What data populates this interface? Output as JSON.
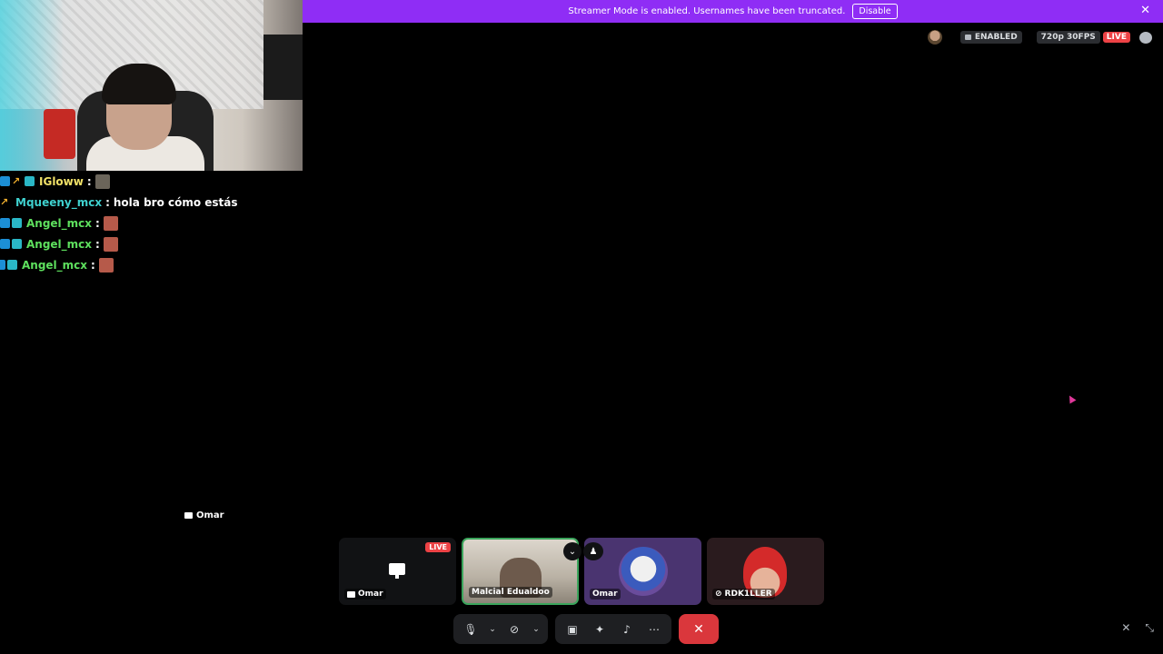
{
  "banner": {
    "message": "Streamer Mode is enabled. Usernames have been truncated.",
    "disable_label": "Disable",
    "close_glyph": "✕"
  },
  "status": {
    "enabled_label": "ENABLED",
    "quality_label": "720p 30FPS",
    "live_label": "LIVE"
  },
  "chat": {
    "messages": [
      {
        "user": "IGloww",
        "text": "",
        "color": "#f2e268"
      },
      {
        "user": "Mqueeny_mcx",
        "text": "hola bro cómo estás",
        "color": "#3fd1cf"
      },
      {
        "user": "Angel_mcx",
        "text": "",
        "color": "#5ee05e"
      },
      {
        "user": "Angel_mcx",
        "text": "",
        "color": "#5ee05e"
      },
      {
        "user": "Angel_mcx",
        "text": "",
        "color": "#5ee05e"
      }
    ],
    "colon": ":"
  },
  "floating_label": "Omar",
  "tiles": [
    {
      "label": "Omar",
      "live": "LIVE"
    },
    {
      "label": "Malcial Edualdoo"
    },
    {
      "label": "Omar"
    },
    {
      "label": "RDK1LLER"
    }
  ],
  "icons": {
    "mic": "mic-icon",
    "camera_off": "camera-off-icon",
    "share_screen": "share-screen-icon",
    "activities": "activities-icon",
    "soundboard": "soundboard-icon",
    "more": "more-icon",
    "disconnect": "disconnect-icon",
    "mute": "volume-mute-icon",
    "fullscreen": "exit-fullscreen-icon"
  },
  "colors": {
    "banner": "#8f2df5",
    "live": "#ed4245",
    "hangup": "#da373c",
    "active_tile": "#3ba55c"
  }
}
